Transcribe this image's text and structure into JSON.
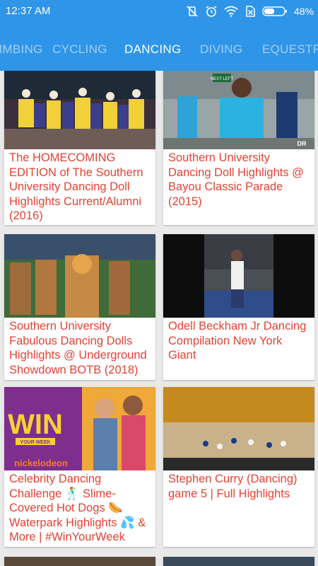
{
  "status_bar": {
    "time": "12:37 AM",
    "battery": "48%"
  },
  "tabs": [
    {
      "label": "CLIMBING",
      "active": false
    },
    {
      "label": "CYCLING",
      "active": false
    },
    {
      "label": "DANCING",
      "active": true
    },
    {
      "label": "DIVING",
      "active": false
    },
    {
      "label": "EQUESTRIAN",
      "active": false
    }
  ],
  "videos": [
    {
      "title": "The HOMECOMING EDITION of The Southern University Dancing Doll Highlights Current/Alumni (2016)"
    },
    {
      "title": "Southern University Dancing Doll Highlights @ Bayou Classic Parade (2015)",
      "thumb_text": "DR",
      "sign_text": "NEXT LEFT"
    },
    {
      "title": "Southern University Fabulous Dancing Dolls Highlights @ Underground Showdown BOTB (2018)"
    },
    {
      "title": "Odell Beckham Jr Dancing Compilation New York Giant"
    },
    {
      "title": "Celebrity Dancing Challenge 🕺 Slime-Covered Hot Dogs 🌭 Waterpark Highlights 💦 & More | #WinYourWeek",
      "thumb_big": "WIN",
      "thumb_small": "YOUR WEEK",
      "thumb_brand": "nickelodeon"
    },
    {
      "title": "Stephen Curry (Dancing) game 5 | Full Highlights"
    }
  ],
  "colors": {
    "app_bar": "#2f95e8",
    "title_text": "#e44232",
    "background": "#e9e9e9"
  }
}
